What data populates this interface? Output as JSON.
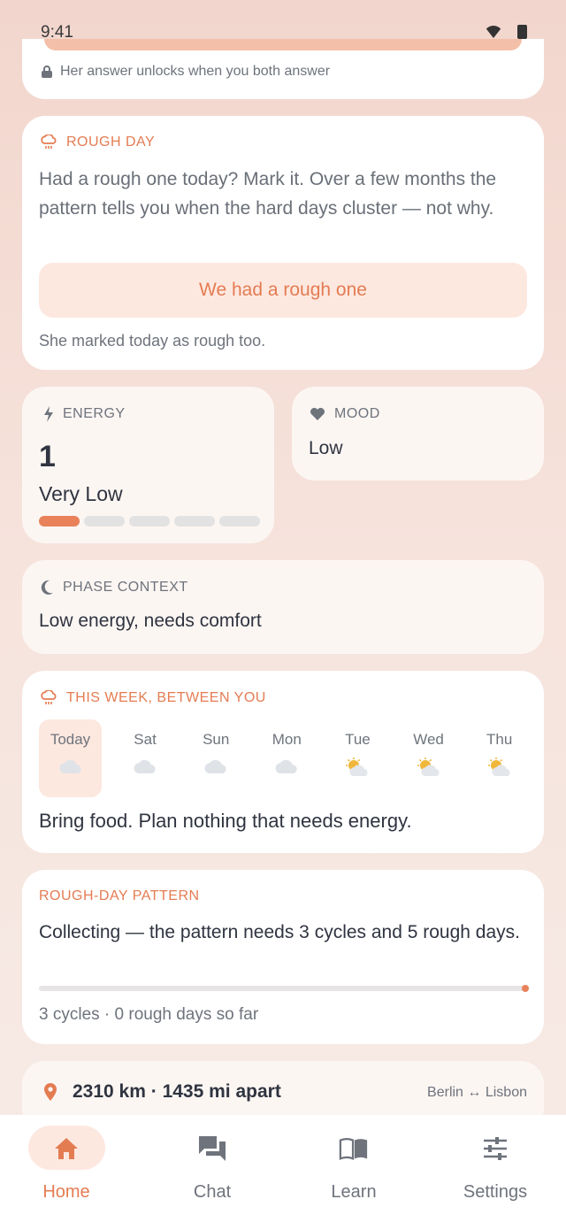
{
  "status_bar": {
    "time": "9:41"
  },
  "answer_card": {
    "lock_text": "Her answer unlocks when you both answer"
  },
  "rough_day": {
    "label": "ROUGH DAY",
    "body": "Had a rough one today? Mark it. Over a few months the pattern tells you when the hard days cluster — not why.",
    "button": "We had a rough one",
    "note": "She marked today as rough too."
  },
  "energy": {
    "label": "ENERGY",
    "value": "1",
    "level": "Very Low",
    "segments_filled": 1,
    "segments_total": 5
  },
  "mood": {
    "label": "MOOD",
    "value": "Low"
  },
  "phase": {
    "label": "PHASE CONTEXT",
    "value": "Low energy, needs comfort"
  },
  "week": {
    "label": "THIS WEEK, BETWEEN YOU",
    "days": [
      {
        "name": "Today",
        "icon": "cloud-icon"
      },
      {
        "name": "Sat",
        "icon": "cloud-icon"
      },
      {
        "name": "Sun",
        "icon": "cloud-icon"
      },
      {
        "name": "Mon",
        "icon": "cloud-icon"
      },
      {
        "name": "Tue",
        "icon": "sun-behind-cloud-icon"
      },
      {
        "name": "Wed",
        "icon": "sun-behind-cloud-icon"
      },
      {
        "name": "Thu",
        "icon": "sun-behind-cloud-icon"
      }
    ],
    "advice": "Bring food. Plan nothing that needs energy."
  },
  "pattern": {
    "label": "ROUGH-DAY PATTERN",
    "value": "Collecting — the pattern needs 3 cycles and 5 rough days.",
    "progress": 1.0,
    "note": "3 cycles · 0 rough days so far"
  },
  "distance": {
    "value": "2310 km · 1435 mi apart",
    "cities": "Berlin ↔ Lisbon"
  },
  "nav": {
    "home": "Home",
    "chat": "Chat",
    "learn": "Learn",
    "settings": "Settings"
  },
  "colors": {
    "accent": "#e47c52",
    "accent_soft": "#fde8e0",
    "text": "#2f3440",
    "muted": "#6e737c"
  }
}
